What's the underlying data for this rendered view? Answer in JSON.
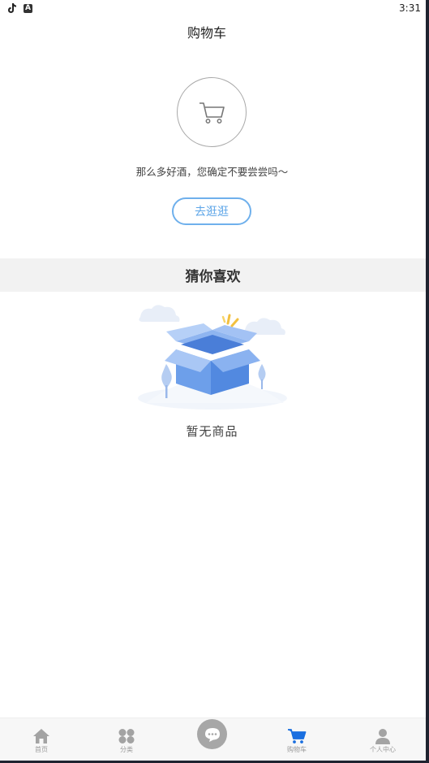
{
  "status_bar": {
    "time": "3:31",
    "icons": [
      "tiktok-icon",
      "a-notification-icon"
    ]
  },
  "header": {
    "title": "购物车"
  },
  "empty_cart": {
    "message": "那么多好酒，您确定不要尝尝吗～",
    "button_label": "去逛逛"
  },
  "recommend": {
    "title": "猜你喜欢",
    "empty_text": "暂无商品"
  },
  "tabbar": {
    "items": [
      {
        "label": "首页",
        "icon": "home-icon"
      },
      {
        "label": "分类",
        "icon": "category-icon"
      },
      {
        "label": "",
        "icon": "chat-icon"
      },
      {
        "label": "购物车",
        "icon": "cart-icon",
        "active": true
      },
      {
        "label": "个人中心",
        "icon": "user-icon"
      }
    ],
    "active_color": "#1a6fe0",
    "inactive_color": "#9a9a9a"
  }
}
